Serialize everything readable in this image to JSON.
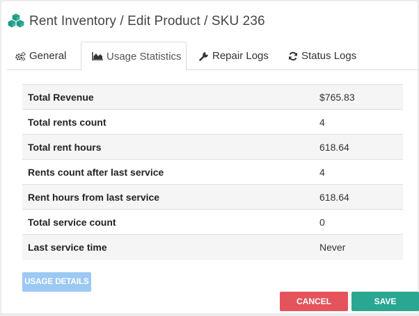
{
  "header": {
    "title": "Rent Inventory / Edit Product / SKU 236",
    "icon": "cubes-icon",
    "icon_color": "#2aa790"
  },
  "tabs": [
    {
      "label": "General",
      "icon": "gears-icon",
      "active": false
    },
    {
      "label": "Usage Statistics",
      "icon": "area-chart-icon",
      "active": true
    },
    {
      "label": "Repair Logs",
      "icon": "wrench-icon",
      "active": false
    },
    {
      "label": "Status Logs",
      "icon": "refresh-icon",
      "active": false
    }
  ],
  "stats": [
    {
      "label": "Total Revenue",
      "value": "$765.83"
    },
    {
      "label": "Total rents count",
      "value": "4"
    },
    {
      "label": "Total rent hours",
      "value": "618.64"
    },
    {
      "label": "Rents count after last service",
      "value": "4"
    },
    {
      "label": "Rent hours from last service",
      "value": "618.64"
    },
    {
      "label": "Total service count",
      "value": "0"
    },
    {
      "label": "Last service time",
      "value": "Never"
    }
  ],
  "buttons": {
    "usage_details": "USAGE DETAILS",
    "cancel": "CANCEL",
    "save": "SAVE"
  },
  "colors": {
    "accent": "#2aa790",
    "danger": "#e5535b",
    "usage_button": "#9cc9f3"
  }
}
